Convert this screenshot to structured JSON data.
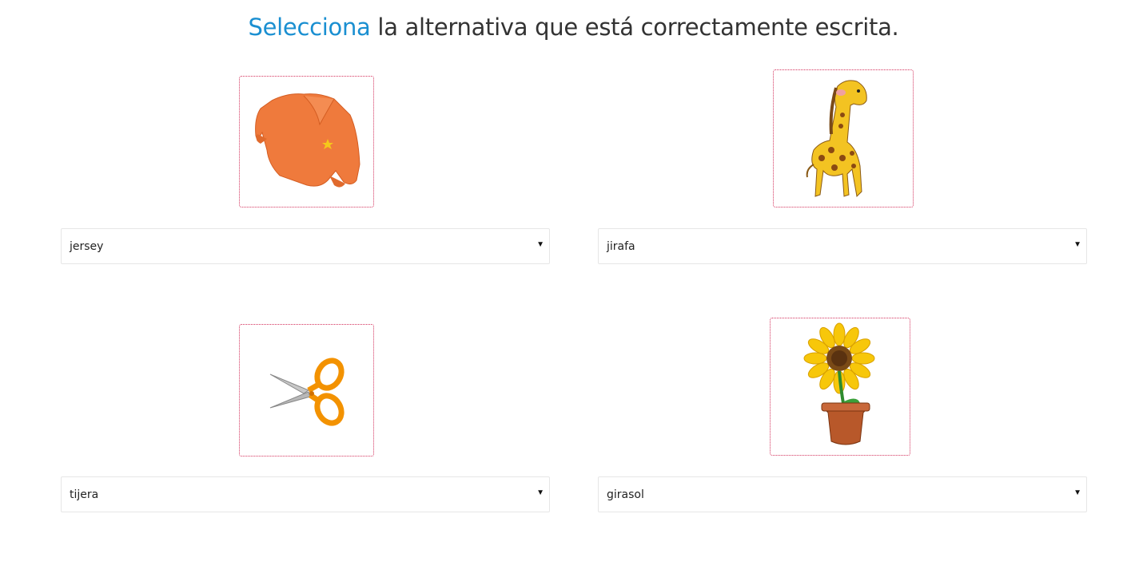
{
  "header": {
    "highlight": "Selecciona",
    "rest": " la alternativa que está correctamente escrita."
  },
  "items": [
    {
      "image": "sweater-image",
      "selected": "jersey"
    },
    {
      "image": "giraffe-image",
      "selected": "jirafa"
    },
    {
      "image": "scissors-image",
      "selected": "tijera"
    },
    {
      "image": "sunflower-image",
      "selected": "girasol"
    }
  ],
  "colors": {
    "accent": "#1a8fd1",
    "frame_border": "#d4325d"
  },
  "icons": {
    "dropdown": "caret-down-icon"
  }
}
